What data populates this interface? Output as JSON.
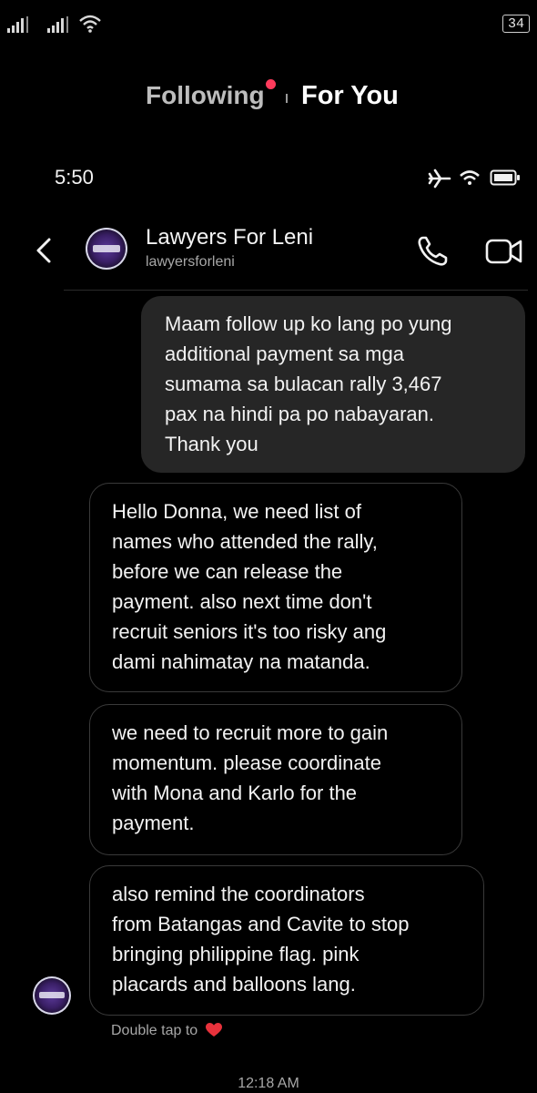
{
  "outer_status": {
    "battery": "34",
    "signal_icons": [
      "signal-icon",
      "signal-icon",
      "wifi-icon"
    ]
  },
  "feed_tabs": {
    "following": "Following",
    "for_you": "For You"
  },
  "inner_status": {
    "time": "5:50",
    "icons": [
      "airplane-icon",
      "wifi-icon",
      "battery-icon"
    ]
  },
  "chat": {
    "name": "Lawyers For Leni",
    "handle": "lawyersforleni"
  },
  "messages": [
    {
      "direction": "sent",
      "lines": [
        "Maam follow up ko lang po yung",
        "additional payment sa mga",
        "sumama sa bulacan rally 3,467",
        "pax na hindi pa po nabayaran.",
        "Thank you"
      ]
    },
    {
      "direction": "received",
      "lines": [
        "Hello Donna, we need list of",
        "names who attended the rally,",
        "before we can release the",
        "payment. also next time don't",
        "recruit seniors it's too risky ang",
        "dami nahimatay na matanda."
      ]
    },
    {
      "direction": "received",
      "lines": [
        "we need to recruit more to gain",
        "momentum. please coordinate",
        "with Mona and Karlo for the",
        "payment."
      ]
    },
    {
      "direction": "received",
      "lines": [
        "also remind the coordinators",
        "from Batangas and Cavite to stop",
        "bringing philippine flag. pink",
        "placards and balloons lang."
      ]
    }
  ],
  "reaction_hint": "Double tap to",
  "timestamp": "12:18 AM",
  "colors": {
    "background": "#000000",
    "sent_bubble": "#262626",
    "received_border": "#3a3a3a",
    "live_dot": "#ff3b5c",
    "heart": "#e8323c"
  }
}
